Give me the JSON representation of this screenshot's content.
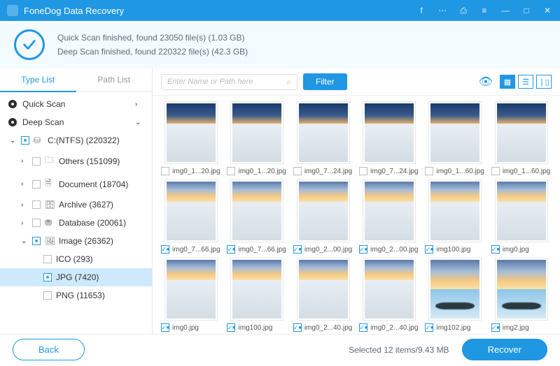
{
  "window": {
    "title": "FoneDog Data Recovery"
  },
  "scan_status": {
    "quick": "Quick Scan finished, found 23050 file(s) (1.03 GB)",
    "deep": "Deep Scan finished, found 220322 file(s) (42.3 GB)"
  },
  "tabs": {
    "type_list": "Type List",
    "path_list": "Path List"
  },
  "tree": {
    "quick_scan": "Quick Scan",
    "deep_scan": "Deep Scan",
    "volume": "C:(NTFS) (220322)",
    "others": "Others (151099)",
    "document": "Document (18704)",
    "archive": "Archive (3627)",
    "database": "Database (20061)",
    "image": "Image (26362)",
    "ico": "ICO (293)",
    "jpg": "JPG (7420)",
    "png": "PNG (11653)"
  },
  "toolbar": {
    "search_placeholder": "Enter Name or Path here",
    "filter": "Filter"
  },
  "files": [
    {
      "name": "img0_1...20.jpg",
      "checked": false,
      "sky": "a"
    },
    {
      "name": "img0_1...20.jpg",
      "checked": false,
      "sky": "a"
    },
    {
      "name": "img0_7...24.jpg",
      "checked": false,
      "sky": "a"
    },
    {
      "name": "img0_7...24.jpg",
      "checked": false,
      "sky": "a"
    },
    {
      "name": "img0_1...60.jpg",
      "checked": false,
      "sky": "a"
    },
    {
      "name": "img0_1...60.jpg",
      "checked": false,
      "sky": "a"
    },
    {
      "name": "img0_7...66.jpg",
      "checked": true,
      "sky": "b"
    },
    {
      "name": "img0_7...66.jpg",
      "checked": true,
      "sky": "b"
    },
    {
      "name": "img0_2...00.jpg",
      "checked": true,
      "sky": "b"
    },
    {
      "name": "img0_2...00.jpg",
      "checked": true,
      "sky": "b"
    },
    {
      "name": "img100.jpg",
      "checked": true,
      "sky": "b"
    },
    {
      "name": "img0.jpg",
      "checked": true,
      "sky": "b"
    },
    {
      "name": "img0.jpg",
      "checked": true,
      "sky": "b"
    },
    {
      "name": "img100.jpg",
      "checked": true,
      "sky": "b"
    },
    {
      "name": "img0_2...40.jpg",
      "checked": true,
      "sky": "b"
    },
    {
      "name": "img0_2...40.jpg",
      "checked": true,
      "sky": "b"
    },
    {
      "name": "img102.jpg",
      "checked": true,
      "sky": "reflect"
    },
    {
      "name": "img2.jpg",
      "checked": true,
      "sky": "reflect"
    }
  ],
  "footer": {
    "back": "Back",
    "selected": "Selected 12 items/9.43 MB",
    "recover": "Recover"
  }
}
